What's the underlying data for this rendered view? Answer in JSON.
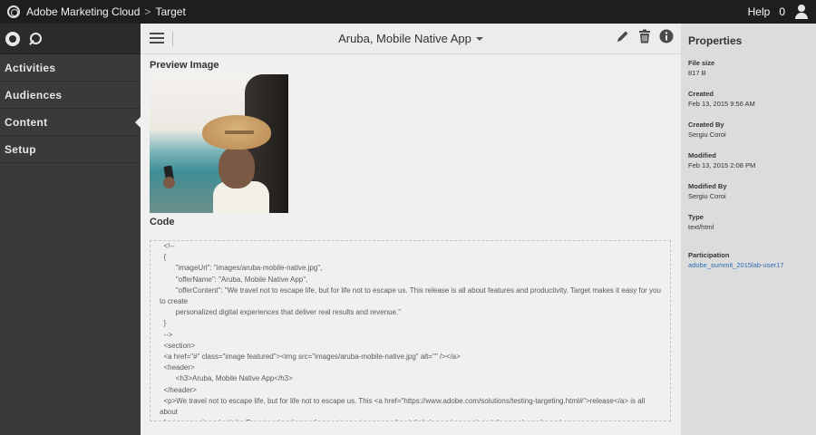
{
  "topbar": {
    "brand": "Adobe Marketing Cloud",
    "separator": ">",
    "crumb": "Target",
    "help_label": "Help",
    "notification_count": "0"
  },
  "sidebar": {
    "items": [
      {
        "label": "Activities",
        "active": false
      },
      {
        "label": "Audiences",
        "active": false
      },
      {
        "label": "Content",
        "active": true
      },
      {
        "label": "Setup",
        "active": false
      }
    ]
  },
  "main": {
    "title": "Aruba, Mobile Native App",
    "preview_label": "Preview Image",
    "code_label": "Code",
    "code": "  <!--\n  {\n        \"imageUrl\": \"images/aruba-mobile-native.jpg\",\n        \"offerName\": \"Aruba, Mobile Native App\",\n        \"offerContent\": \"We travel not to escape life, but for life not to escape us. This release is all about features and productivity. Target makes it easy for you to create\n        personalized digital experiences that deliver real results and revenue.\"\n  }\n  -->\n  <section>\n  <a href=\"#\" class=\"image featured\"><img src=\"images/aruba-mobile-native.jpg\" alt=\"\" /></a>\n  <header>\n        <h3>Aruba, Mobile Native App</h3>\n  </header>\n  <p>We travel not to escape life, but for life not to escape us. This <a href=\"https://www.adobe.com/solutions/testing-targeting.html#\">release</a> is all about\n  features and productivity. Target makes it easy for you to create personalized digital experiences that deliver real results and revenue.\n  </section>"
  },
  "properties": {
    "heading": "Properties",
    "file_size_label": "File size",
    "file_size": "817 B",
    "created_label": "Created",
    "created": "Feb 13, 2015 9:56 AM",
    "created_by_label": "Created By",
    "created_by": "Sergiu Coroi",
    "modified_label": "Modified",
    "modified": "Feb 13, 2015 2:08 PM",
    "modified_by_label": "Modified By",
    "modified_by": "Sergiu Coroi",
    "type_label": "Type",
    "type": "text/html",
    "participation_label": "Participation",
    "participation": "adobe_summit_2015lab-user17"
  },
  "colors": {
    "topbar": "#1e1e1e",
    "sidebar": "#3a3a3a",
    "main_bg": "#f0f0f0",
    "properties_bg": "#dcdcdc",
    "link": "#2a6fb3"
  },
  "icons": [
    "adobe-logo-icon",
    "search-icon",
    "hamburger-icon",
    "pencil-icon",
    "trash-icon",
    "info-icon",
    "user-icon",
    "dropdown-caret-icon"
  ]
}
